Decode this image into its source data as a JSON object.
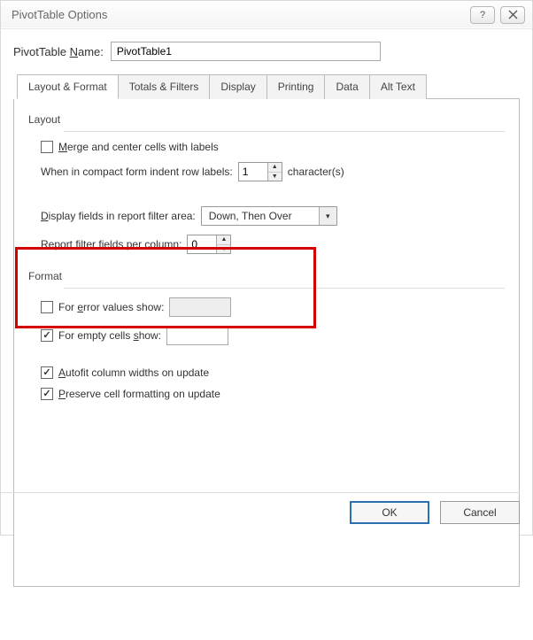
{
  "window": {
    "title": "PivotTable Options"
  },
  "nameRow": {
    "label_pre": "PivotTable ",
    "label_u": "N",
    "label_post": "ame:",
    "value": "PivotTable1"
  },
  "tabs": {
    "items": [
      {
        "label": "Layout & Format"
      },
      {
        "label": "Totals & Filters"
      },
      {
        "label": "Display"
      },
      {
        "label": "Printing"
      },
      {
        "label": "Data"
      },
      {
        "label": "Alt Text"
      }
    ]
  },
  "layout": {
    "group": "Layout",
    "merge_u": "M",
    "merge_post": "erge and center cells with labels",
    "indent_pre": "When in compact form indent row labels:",
    "indent_value": "1",
    "indent_post": "character(s)",
    "display_pre_u": "D",
    "display_post": "isplay fields in report filter area:",
    "display_value": "Down, Then Over",
    "perCol_pre": "Report filter ",
    "perCol_u": "f",
    "perCol_post": "ields per column:",
    "perCol_value": "0"
  },
  "format": {
    "group": "Format",
    "error_pre": "For ",
    "error_u": "e",
    "error_post": "rror values show:",
    "error_value": "",
    "empty_pre": "For empty cells ",
    "empty_u": "s",
    "empty_post": "how:",
    "empty_value": "",
    "autofit_u": "A",
    "autofit_post": "utofit column widths on update",
    "preserve_u": "P",
    "preserve_post": "reserve cell formatting on update"
  },
  "buttons": {
    "ok": "OK",
    "cancel": "Cancel"
  }
}
